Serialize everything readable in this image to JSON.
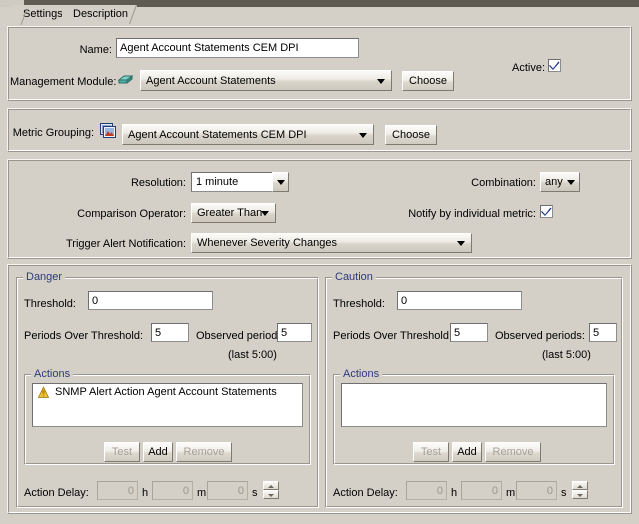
{
  "window": {
    "tabs": [
      {
        "id": "settings",
        "label": "Settings",
        "selected": true
      },
      {
        "id": "description",
        "label": "Description",
        "selected": false
      }
    ]
  },
  "identity_panel": {
    "name_label": "Name:",
    "name_value": "Agent Account Statements CEM DPI",
    "management_module_label": "Management Module:",
    "management_module_icon": "module-icon",
    "management_module_value": "Agent Account Statements",
    "management_module_choose": "Choose",
    "active_label": "Active:",
    "active_checked": true
  },
  "metric_panel": {
    "metric_grouping_label": "Metric Grouping:",
    "metric_grouping_icon": "metric-grouping-icon",
    "metric_grouping_value": "Agent Account Statements CEM DPI",
    "metric_grouping_choose": "Choose"
  },
  "condition_panel": {
    "resolution_label": "Resolution:",
    "resolution_value": "1 minute",
    "comparison_operator_label": "Comparison Operator:",
    "comparison_operator_value": "Greater Than",
    "trigger_alert_label": "Trigger Alert Notification:",
    "trigger_alert_value": "Whenever Severity Changes",
    "combination_label": "Combination:",
    "combination_value": "any",
    "notify_label": "Notify by individual metric:",
    "notify_checked": true
  },
  "severity_groups": [
    {
      "id": "danger",
      "title": "Danger",
      "threshold_label": "Threshold:",
      "threshold_value": "0",
      "periods_label": "Periods Over Threshold:",
      "periods_value": "5",
      "observed_label": "Observed periods:",
      "observed_value": "5",
      "last_note": "(last 5:00)",
      "actions_title": "Actions",
      "actions": [
        {
          "icon": "alert-bell-icon",
          "label": "SNMP Alert Action Agent Account Statements"
        }
      ],
      "buttons": [
        {
          "id": "test",
          "label": "Test",
          "enabled": false
        },
        {
          "id": "add",
          "label": "Add",
          "enabled": true
        },
        {
          "id": "remove",
          "label": "Remove",
          "enabled": false
        }
      ],
      "action_delay_label": "Action Delay:",
      "delay_hours": "0",
      "delay_hours_unit": "h",
      "delay_minutes": "0",
      "delay_minutes_unit": "m",
      "delay_seconds": "0",
      "delay_seconds_unit": "s"
    },
    {
      "id": "caution",
      "title": "Caution",
      "threshold_label": "Threshold:",
      "threshold_value": "0",
      "periods_label": "Periods Over Threshold:",
      "periods_value": "5",
      "observed_label": "Observed periods:",
      "observed_value": "5",
      "last_note": "(last 5:00)",
      "actions_title": "Actions",
      "actions": [],
      "buttons": [
        {
          "id": "test",
          "label": "Test",
          "enabled": false
        },
        {
          "id": "add",
          "label": "Add",
          "enabled": true
        },
        {
          "id": "remove",
          "label": "Remove",
          "enabled": false
        }
      ],
      "action_delay_label": "Action Delay:",
      "delay_hours": "0",
      "delay_hours_unit": "h",
      "delay_minutes": "0",
      "delay_minutes_unit": "m",
      "delay_seconds": "0",
      "delay_seconds_unit": "s"
    }
  ],
  "colors": {
    "background": "#d4d0c8",
    "group_title": "#2e3a7a",
    "field_background": "#ffffff",
    "disabled_text": "#a5a19a",
    "checkbox_check": "#1a2f8a",
    "alert_icon": "#e0a81e"
  }
}
